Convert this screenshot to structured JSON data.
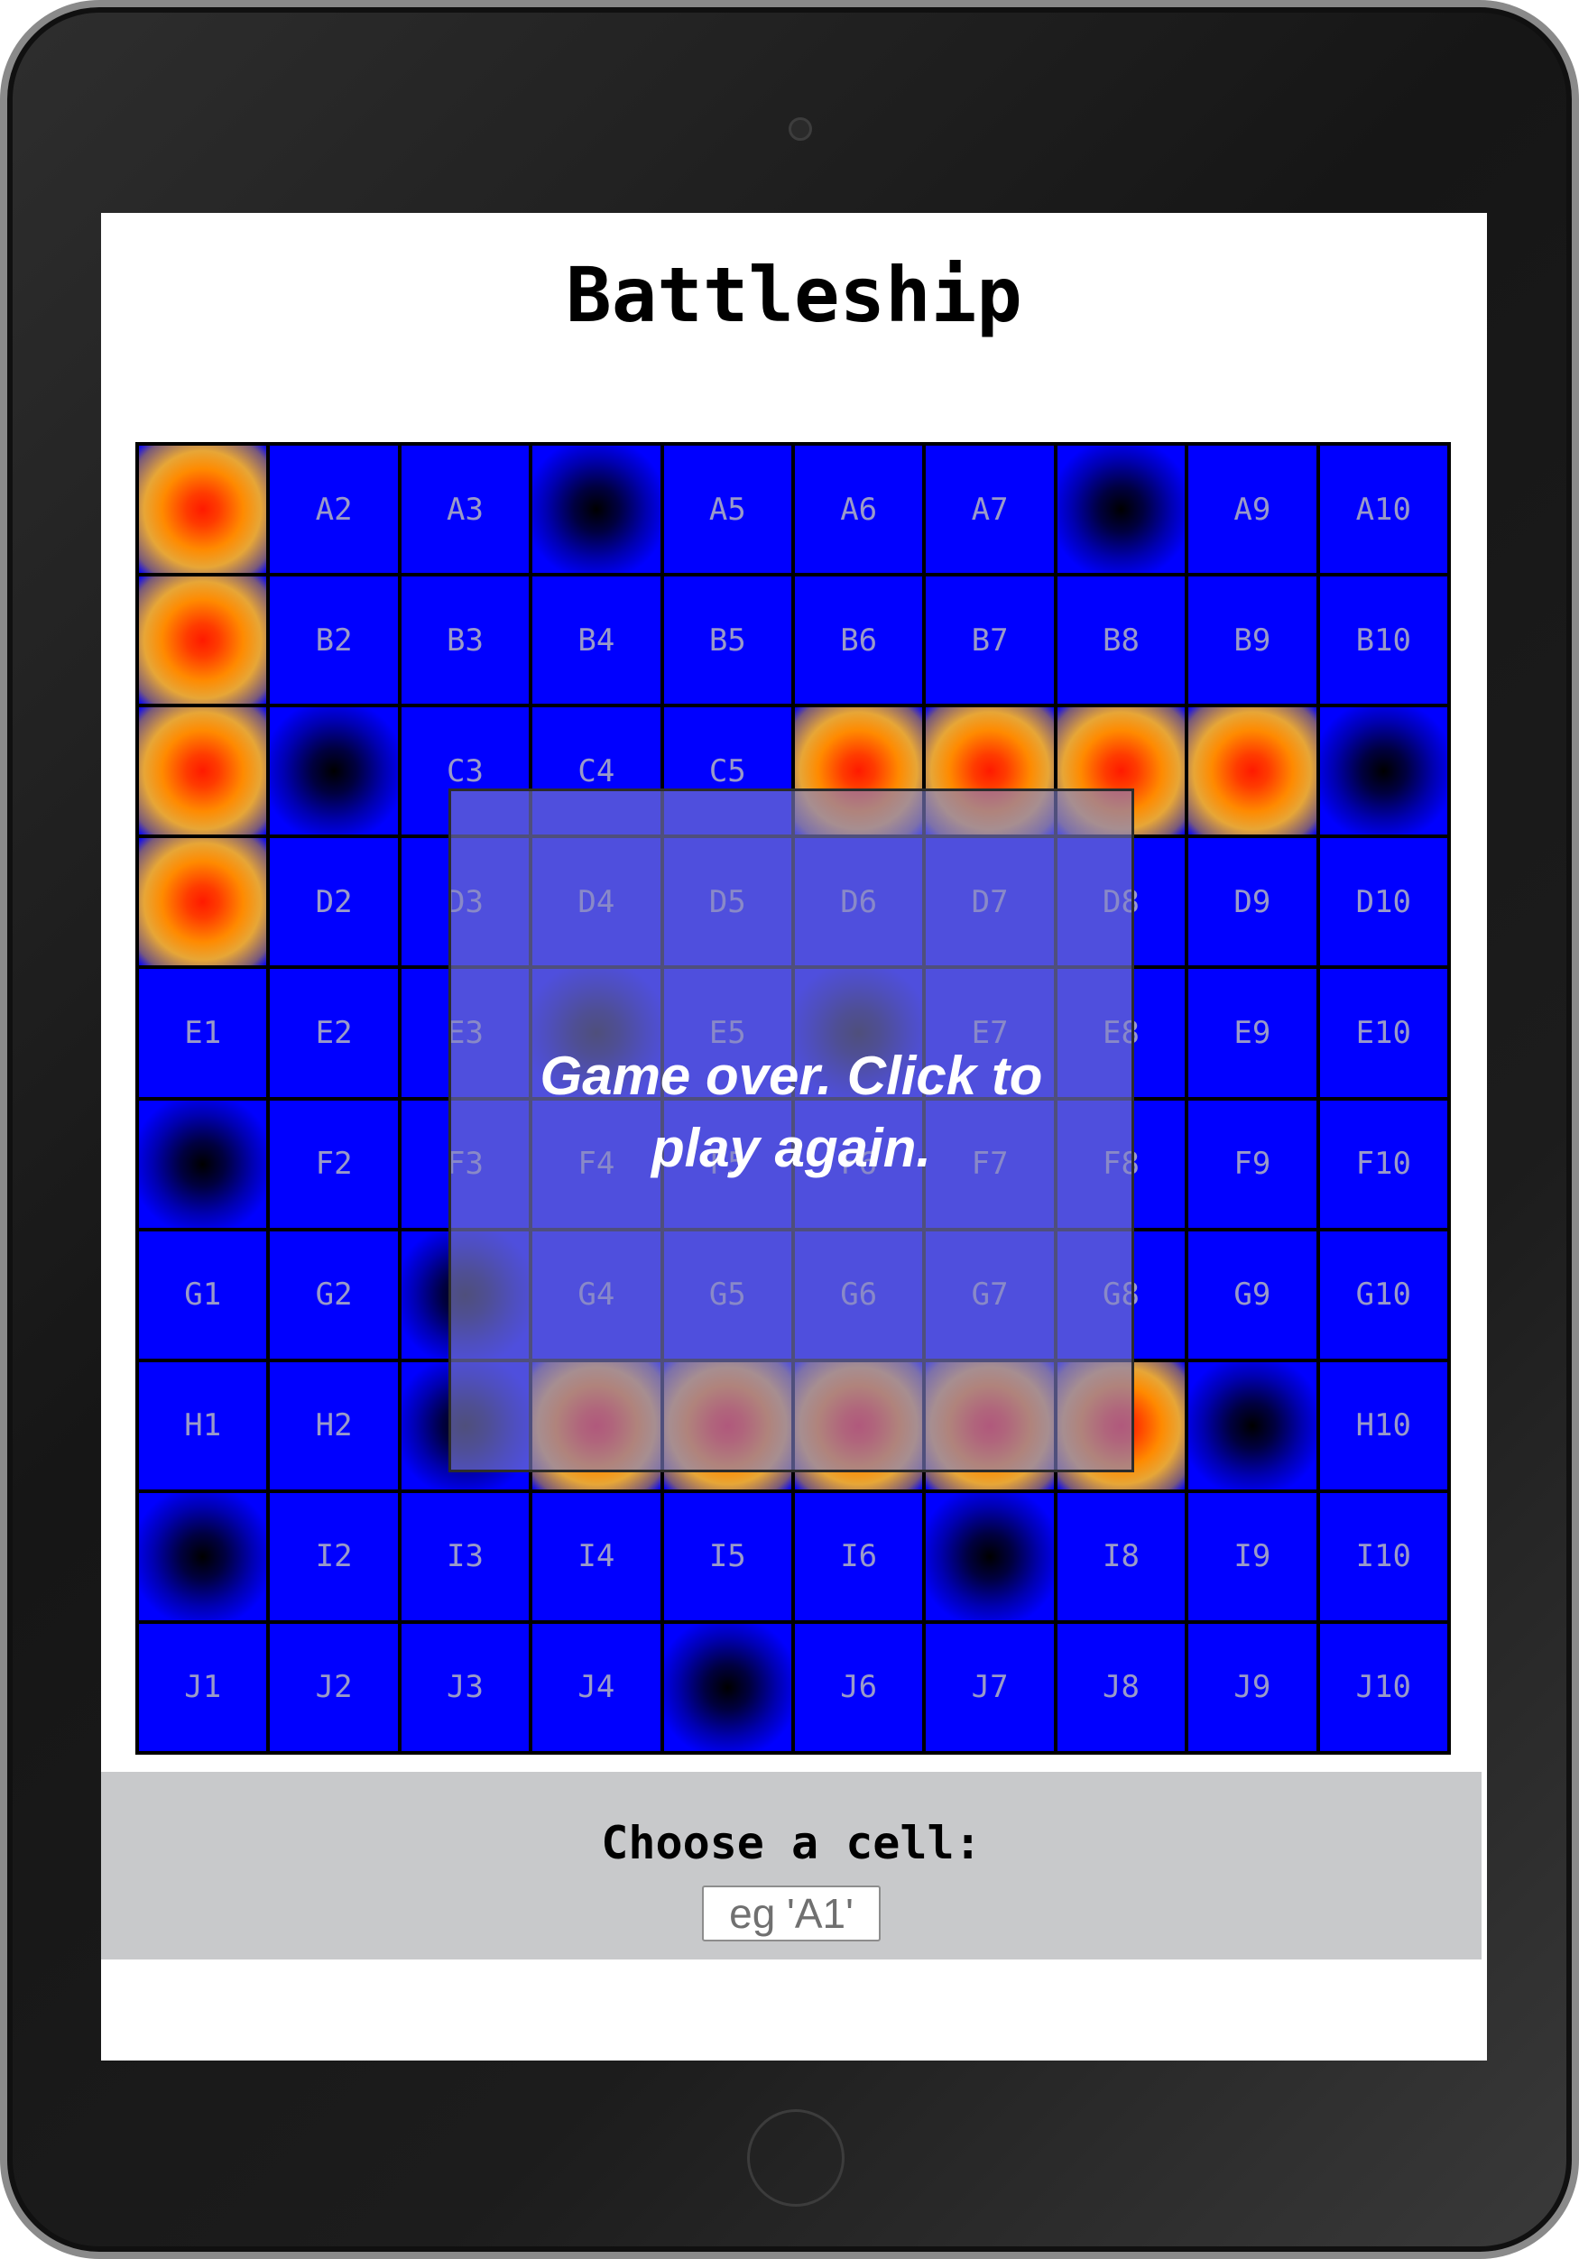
{
  "app": {
    "title": "Battleship"
  },
  "board": {
    "rows": [
      "A",
      "B",
      "C",
      "D",
      "E",
      "F",
      "G",
      "H",
      "I",
      "J"
    ],
    "cols": [
      1,
      2,
      3,
      4,
      5,
      6,
      7,
      8,
      9,
      10
    ],
    "hits": [
      "A1",
      "B1",
      "C1",
      "D1",
      "C6",
      "C7",
      "C8",
      "C9",
      "H4",
      "H5",
      "H6",
      "H7",
      "H8"
    ],
    "misses": [
      "A4",
      "A8",
      "C2",
      "C10",
      "E4",
      "E6",
      "F1",
      "G3",
      "H3",
      "H9",
      "I1",
      "I7",
      "J5"
    ],
    "colors": {
      "water": "#0000ff",
      "hit": "#ff3b00",
      "miss": "#000000"
    }
  },
  "overlay": {
    "message": "Game over. Click to play again."
  },
  "controls": {
    "prompt": "Choose a cell:",
    "input_placeholder": "eg 'A1'",
    "input_value": ""
  }
}
